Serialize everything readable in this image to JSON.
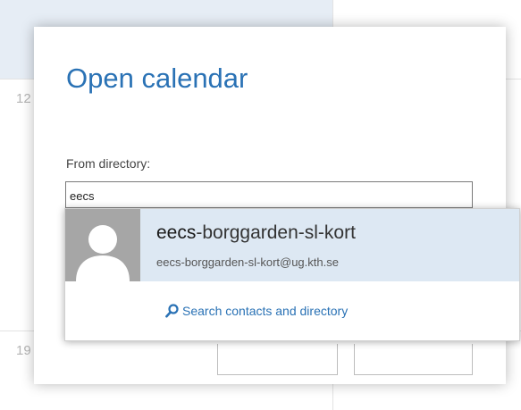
{
  "background": {
    "day_numbers": [
      "12",
      "19"
    ]
  },
  "dialog": {
    "title": "Open calendar",
    "field_label": "From directory:",
    "input_value": "eecs"
  },
  "suggestions": {
    "item": {
      "name_match": "eecs",
      "name_rest": "-borggarden-sl-kort",
      "email": "eecs-borggarden-sl-kort@ug.kth.se",
      "avatar_icon": "person-silhouette-icon"
    },
    "search_link_label": "Search contacts and directory",
    "search_icon": "search-icon"
  },
  "colors": {
    "accent": "#2a72b5",
    "highlight": "#dde8f3",
    "avatar_bg": "#a6a6a6"
  }
}
